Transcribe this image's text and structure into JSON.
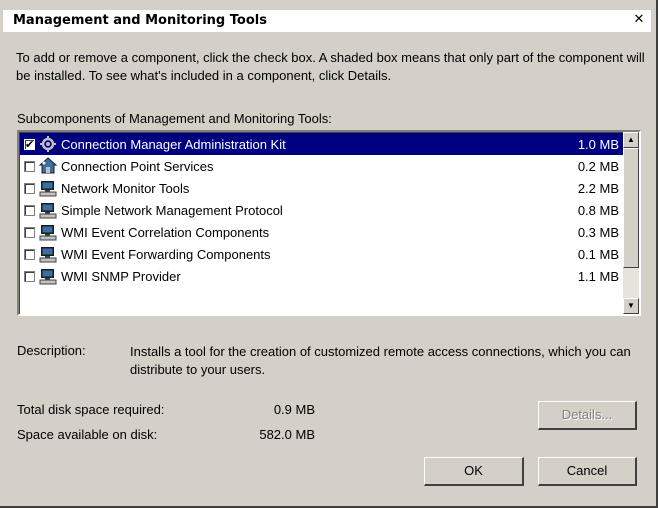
{
  "dialog": {
    "title": "Management and Monitoring Tools",
    "close_glyph": "✕",
    "intro": "To add or remove a component, click the check box. A shaded box means that only part of the component will be installed. To see what's included in a component, click Details.",
    "subcomponents_label": "Subcomponents of Management and Monitoring Tools:"
  },
  "components": [
    {
      "name": "Connection Manager Administration Kit",
      "size": "1.0 MB",
      "checked": true,
      "selected": true,
      "icon": "cmak-icon"
    },
    {
      "name": "Connection Point Services",
      "size": "0.2 MB",
      "checked": false,
      "selected": false,
      "icon": "house-network-icon"
    },
    {
      "name": "Network Monitor Tools",
      "size": "2.2 MB",
      "checked": false,
      "selected": false,
      "icon": "computer-icon"
    },
    {
      "name": "Simple Network Management Protocol",
      "size": "0.8 MB",
      "checked": false,
      "selected": false,
      "icon": "computer-icon"
    },
    {
      "name": "WMI Event Correlation Components",
      "size": "0.3 MB",
      "checked": false,
      "selected": false,
      "icon": "computer-icon"
    },
    {
      "name": "WMI Event Forwarding Components",
      "size": "0.1 MB",
      "checked": false,
      "selected": false,
      "icon": "computer-icon"
    },
    {
      "name": "WMI SNMP Provider",
      "size": "1.1 MB",
      "checked": false,
      "selected": false,
      "icon": "computer-icon"
    }
  ],
  "description": {
    "label": "Description:",
    "text": "Installs a tool for the creation of customized remote access connections, which you can distribute to your users."
  },
  "disk": {
    "total_label": "Total disk space required:",
    "total_value": "0.9 MB",
    "available_label": "Space available on disk:",
    "available_value": "582.0 MB"
  },
  "buttons": {
    "details": "Details...",
    "ok": "OK",
    "cancel": "Cancel"
  },
  "colors": {
    "selection": "#000080",
    "face": "#d4d0c8"
  }
}
